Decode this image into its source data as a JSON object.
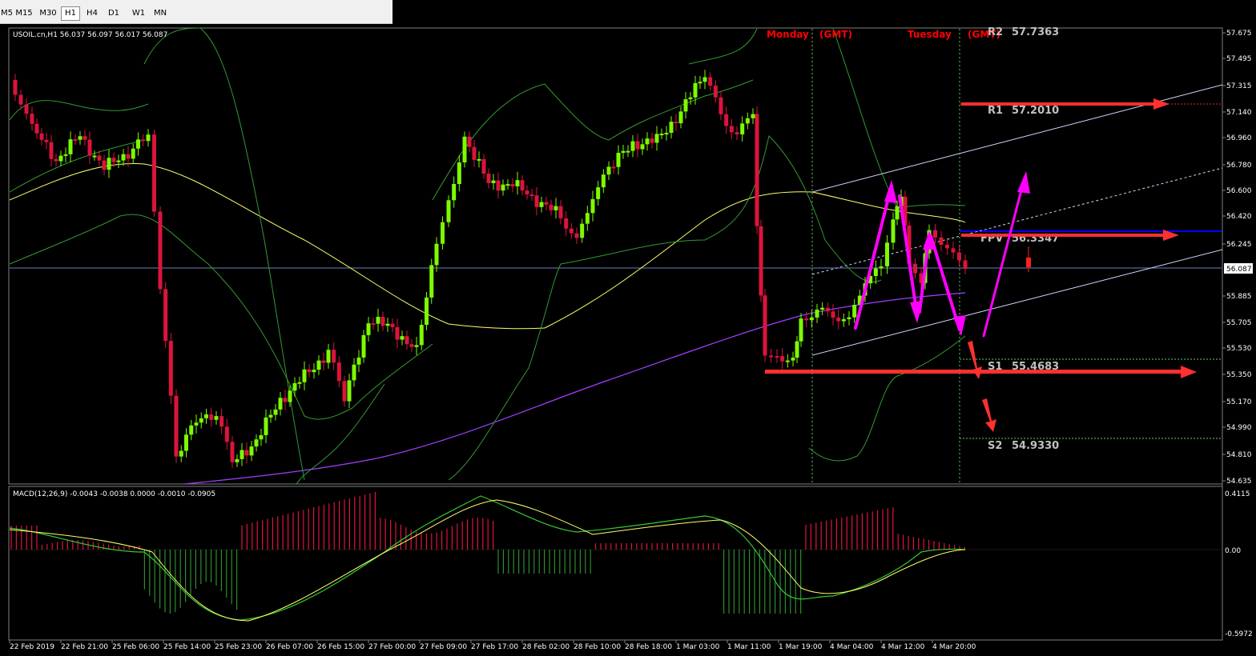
{
  "toolbar": {
    "timeframes": [
      {
        "label": "M5",
        "active": false
      },
      {
        "label": "M15",
        "active": false
      },
      {
        "label": "M30",
        "active": false
      },
      {
        "label": "H1",
        "active": true
      },
      {
        "label": "H4",
        "active": false
      },
      {
        "label": "D1",
        "active": false
      },
      {
        "label": "W1",
        "active": false
      },
      {
        "label": "MN",
        "active": false
      }
    ]
  },
  "chart": {
    "header": "USOIL.cn,H1  56.037 56.097 56.017 56.087",
    "macd_header": "MACD(12,26,9) -0.0043 -0.0038 0.0000 -0.0010 -0.0905",
    "session_labels": [
      {
        "day": "Monday",
        "tz": "(GMT)"
      },
      {
        "day": "Tuesday",
        "tz": "(GMT)"
      }
    ],
    "price_ticks": [
      "57.675",
      "57.495",
      "57.315",
      "57.140",
      "56.960",
      "56.780",
      "56.600",
      "56.420",
      "56.245",
      "56.087",
      "55.885",
      "55.705",
      "55.530",
      "55.350",
      "55.170",
      "54.990",
      "54.810",
      "54.635"
    ],
    "current_price": "56.087",
    "macd_ticks": [
      "0.4115",
      "0.00",
      "-0.5972"
    ],
    "time_ticks": [
      "22 Feb 2019",
      "22 Feb 21:00",
      "25 Feb 06:00",
      "25 Feb 14:00",
      "25 Feb 23:00",
      "26 Feb 07:00",
      "26 Feb 15:00",
      "27 Feb 00:00",
      "27 Feb 09:00",
      "27 Feb 17:00",
      "28 Feb 02:00",
      "28 Feb 10:00",
      "28 Feb 18:00",
      "1 Mar 03:00",
      "1 Mar 11:00",
      "1 Mar 19:00",
      "4 Mar 04:00",
      "4 Mar 12:00",
      "4 Mar 20:00"
    ],
    "pivot_levels": [
      {
        "label": "R2",
        "value": "57.7363"
      },
      {
        "label": "R1",
        "value": "57.2010"
      },
      {
        "label": "FPV",
        "value": "56.3347"
      },
      {
        "label": "S1",
        "value": "55.4683"
      },
      {
        "label": "S2",
        "value": "54.9330"
      }
    ],
    "colors": {
      "bull": "#7cfc00",
      "bear": "#dc143c",
      "session": "#ff0000",
      "pivot_text": "#c0c0c0",
      "magenta": "#ff00ff",
      "arrow_red": "#ff3030",
      "ma_yellow": "#ffff66",
      "ma_purple": "#a040ff",
      "bands": "#66cc66",
      "fpv_line": "#0000ff"
    }
  }
}
